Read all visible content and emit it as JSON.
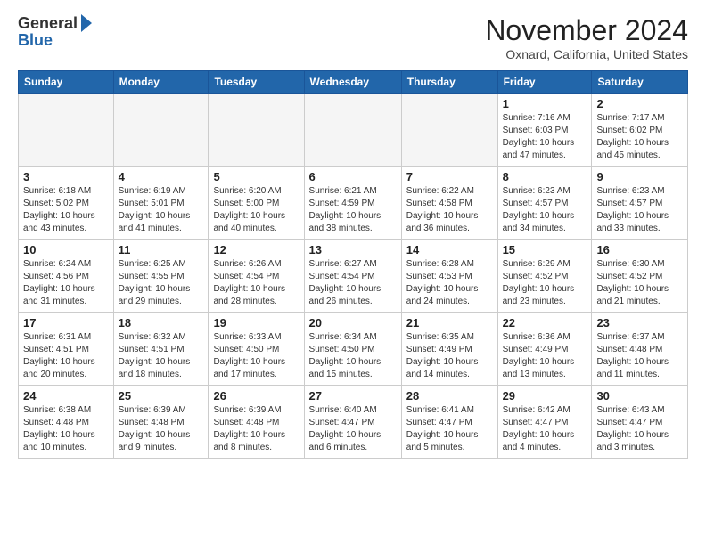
{
  "logo": {
    "general": "General",
    "blue": "Blue"
  },
  "title": "November 2024",
  "subtitle": "Oxnard, California, United States",
  "weekdays": [
    "Sunday",
    "Monday",
    "Tuesday",
    "Wednesday",
    "Thursday",
    "Friday",
    "Saturday"
  ],
  "weeks": [
    [
      {
        "day": "",
        "info": ""
      },
      {
        "day": "",
        "info": ""
      },
      {
        "day": "",
        "info": ""
      },
      {
        "day": "",
        "info": ""
      },
      {
        "day": "",
        "info": ""
      },
      {
        "day": "1",
        "info": "Sunrise: 7:16 AM\nSunset: 6:03 PM\nDaylight: 10 hours and 47 minutes."
      },
      {
        "day": "2",
        "info": "Sunrise: 7:17 AM\nSunset: 6:02 PM\nDaylight: 10 hours and 45 minutes."
      }
    ],
    [
      {
        "day": "3",
        "info": "Sunrise: 6:18 AM\nSunset: 5:02 PM\nDaylight: 10 hours and 43 minutes."
      },
      {
        "day": "4",
        "info": "Sunrise: 6:19 AM\nSunset: 5:01 PM\nDaylight: 10 hours and 41 minutes."
      },
      {
        "day": "5",
        "info": "Sunrise: 6:20 AM\nSunset: 5:00 PM\nDaylight: 10 hours and 40 minutes."
      },
      {
        "day": "6",
        "info": "Sunrise: 6:21 AM\nSunset: 4:59 PM\nDaylight: 10 hours and 38 minutes."
      },
      {
        "day": "7",
        "info": "Sunrise: 6:22 AM\nSunset: 4:58 PM\nDaylight: 10 hours and 36 minutes."
      },
      {
        "day": "8",
        "info": "Sunrise: 6:23 AM\nSunset: 4:57 PM\nDaylight: 10 hours and 34 minutes."
      },
      {
        "day": "9",
        "info": "Sunrise: 6:23 AM\nSunset: 4:57 PM\nDaylight: 10 hours and 33 minutes."
      }
    ],
    [
      {
        "day": "10",
        "info": "Sunrise: 6:24 AM\nSunset: 4:56 PM\nDaylight: 10 hours and 31 minutes."
      },
      {
        "day": "11",
        "info": "Sunrise: 6:25 AM\nSunset: 4:55 PM\nDaylight: 10 hours and 29 minutes."
      },
      {
        "day": "12",
        "info": "Sunrise: 6:26 AM\nSunset: 4:54 PM\nDaylight: 10 hours and 28 minutes."
      },
      {
        "day": "13",
        "info": "Sunrise: 6:27 AM\nSunset: 4:54 PM\nDaylight: 10 hours and 26 minutes."
      },
      {
        "day": "14",
        "info": "Sunrise: 6:28 AM\nSunset: 4:53 PM\nDaylight: 10 hours and 24 minutes."
      },
      {
        "day": "15",
        "info": "Sunrise: 6:29 AM\nSunset: 4:52 PM\nDaylight: 10 hours and 23 minutes."
      },
      {
        "day": "16",
        "info": "Sunrise: 6:30 AM\nSunset: 4:52 PM\nDaylight: 10 hours and 21 minutes."
      }
    ],
    [
      {
        "day": "17",
        "info": "Sunrise: 6:31 AM\nSunset: 4:51 PM\nDaylight: 10 hours and 20 minutes."
      },
      {
        "day": "18",
        "info": "Sunrise: 6:32 AM\nSunset: 4:51 PM\nDaylight: 10 hours and 18 minutes."
      },
      {
        "day": "19",
        "info": "Sunrise: 6:33 AM\nSunset: 4:50 PM\nDaylight: 10 hours and 17 minutes."
      },
      {
        "day": "20",
        "info": "Sunrise: 6:34 AM\nSunset: 4:50 PM\nDaylight: 10 hours and 15 minutes."
      },
      {
        "day": "21",
        "info": "Sunrise: 6:35 AM\nSunset: 4:49 PM\nDaylight: 10 hours and 14 minutes."
      },
      {
        "day": "22",
        "info": "Sunrise: 6:36 AM\nSunset: 4:49 PM\nDaylight: 10 hours and 13 minutes."
      },
      {
        "day": "23",
        "info": "Sunrise: 6:37 AM\nSunset: 4:48 PM\nDaylight: 10 hours and 11 minutes."
      }
    ],
    [
      {
        "day": "24",
        "info": "Sunrise: 6:38 AM\nSunset: 4:48 PM\nDaylight: 10 hours and 10 minutes."
      },
      {
        "day": "25",
        "info": "Sunrise: 6:39 AM\nSunset: 4:48 PM\nDaylight: 10 hours and 9 minutes."
      },
      {
        "day": "26",
        "info": "Sunrise: 6:39 AM\nSunset: 4:48 PM\nDaylight: 10 hours and 8 minutes."
      },
      {
        "day": "27",
        "info": "Sunrise: 6:40 AM\nSunset: 4:47 PM\nDaylight: 10 hours and 6 minutes."
      },
      {
        "day": "28",
        "info": "Sunrise: 6:41 AM\nSunset: 4:47 PM\nDaylight: 10 hours and 5 minutes."
      },
      {
        "day": "29",
        "info": "Sunrise: 6:42 AM\nSunset: 4:47 PM\nDaylight: 10 hours and 4 minutes."
      },
      {
        "day": "30",
        "info": "Sunrise: 6:43 AM\nSunset: 4:47 PM\nDaylight: 10 hours and 3 minutes."
      }
    ]
  ]
}
